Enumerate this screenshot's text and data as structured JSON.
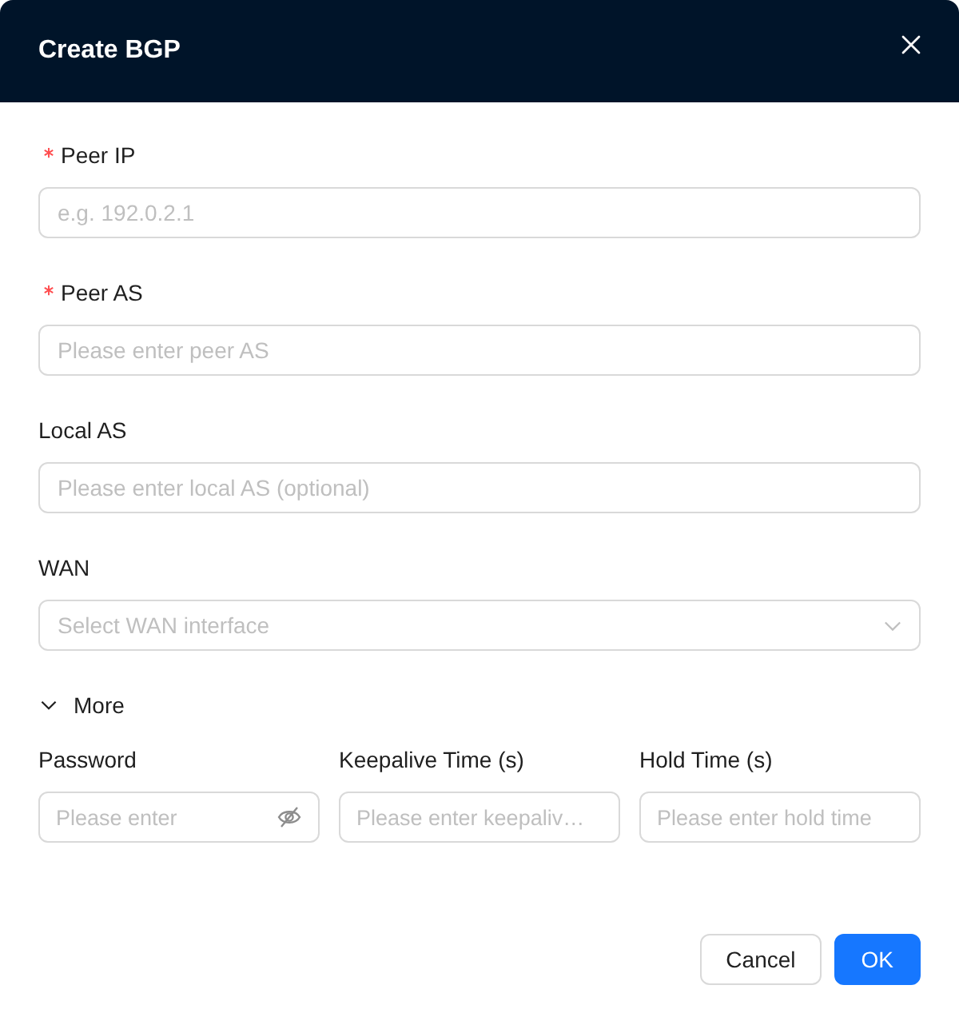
{
  "dialog": {
    "title": "Create BGP"
  },
  "fields": [
    {
      "label": "Peer IP",
      "required": true,
      "kind": "input",
      "placeholder": "e.g. 192.0.2.1"
    },
    {
      "label": "Peer AS",
      "required": true,
      "kind": "input",
      "placeholder": "Please enter peer AS"
    },
    {
      "label": "Local AS",
      "required": false,
      "kind": "input",
      "placeholder": "Please enter local AS (optional)"
    },
    {
      "label": "WAN",
      "required": false,
      "kind": "select",
      "placeholder": "Select WAN interface"
    }
  ],
  "more": {
    "label": "More",
    "expanded": true,
    "fields": [
      {
        "label": "Password",
        "kind": "password",
        "placeholder": "Please enter"
      },
      {
        "label": "Keepalive Time (s)",
        "kind": "input",
        "placeholder": "Please enter keepaliv…"
      },
      {
        "label": "Hold Time (s)",
        "kind": "input",
        "placeholder": "Please enter hold time"
      }
    ]
  },
  "buttons": [
    {
      "label": "Cancel",
      "kind": "default"
    },
    {
      "label": "OK",
      "kind": "primary"
    }
  ]
}
